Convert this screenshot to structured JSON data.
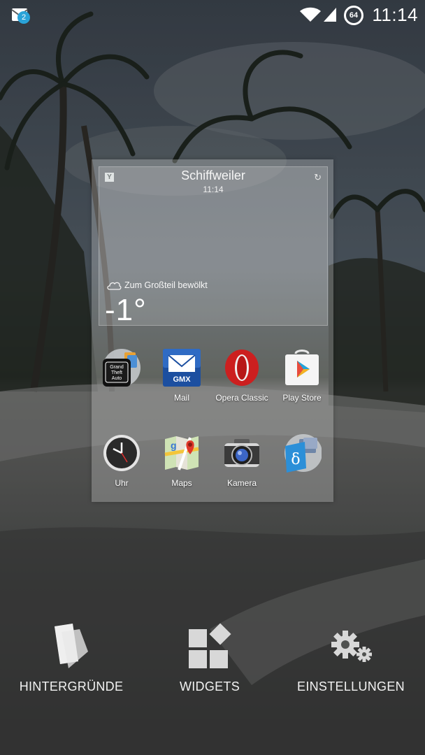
{
  "status_bar": {
    "notification_count": "2",
    "battery_percent": "64",
    "time": "11:14",
    "icons": [
      "notification-icon",
      "wifi-icon",
      "cell-signal-icon",
      "battery-icon"
    ]
  },
  "weather_widget": {
    "city": "Schiffweiler",
    "time": "11:14",
    "condition": "Zum Großteil bewölkt",
    "temperature": "-1°"
  },
  "apps": [
    {
      "label": "",
      "icon": "folder-icon"
    },
    {
      "label": "Mail",
      "icon": "gmx-mail-icon"
    },
    {
      "label": "Opera Classic",
      "icon": "opera-icon"
    },
    {
      "label": "Play Store",
      "icon": "play-store-icon"
    },
    {
      "label": "Uhr",
      "icon": "clock-icon"
    },
    {
      "label": "Maps",
      "icon": "maps-icon"
    },
    {
      "label": "Kamera",
      "icon": "camera-icon"
    },
    {
      "label": "",
      "icon": "folder-icon"
    }
  ],
  "options": [
    {
      "label": "HINTERGRÜNDE",
      "icon": "wallpapers-icon"
    },
    {
      "label": "WIDGETS",
      "icon": "widgets-icon"
    },
    {
      "label": "EINSTELLUNGEN",
      "icon": "settings-icon"
    }
  ],
  "colors": {
    "accent_badge": "#2aa3d8",
    "opera_red": "#cc1f1f",
    "gmx_blue": "#1c4fa0"
  }
}
